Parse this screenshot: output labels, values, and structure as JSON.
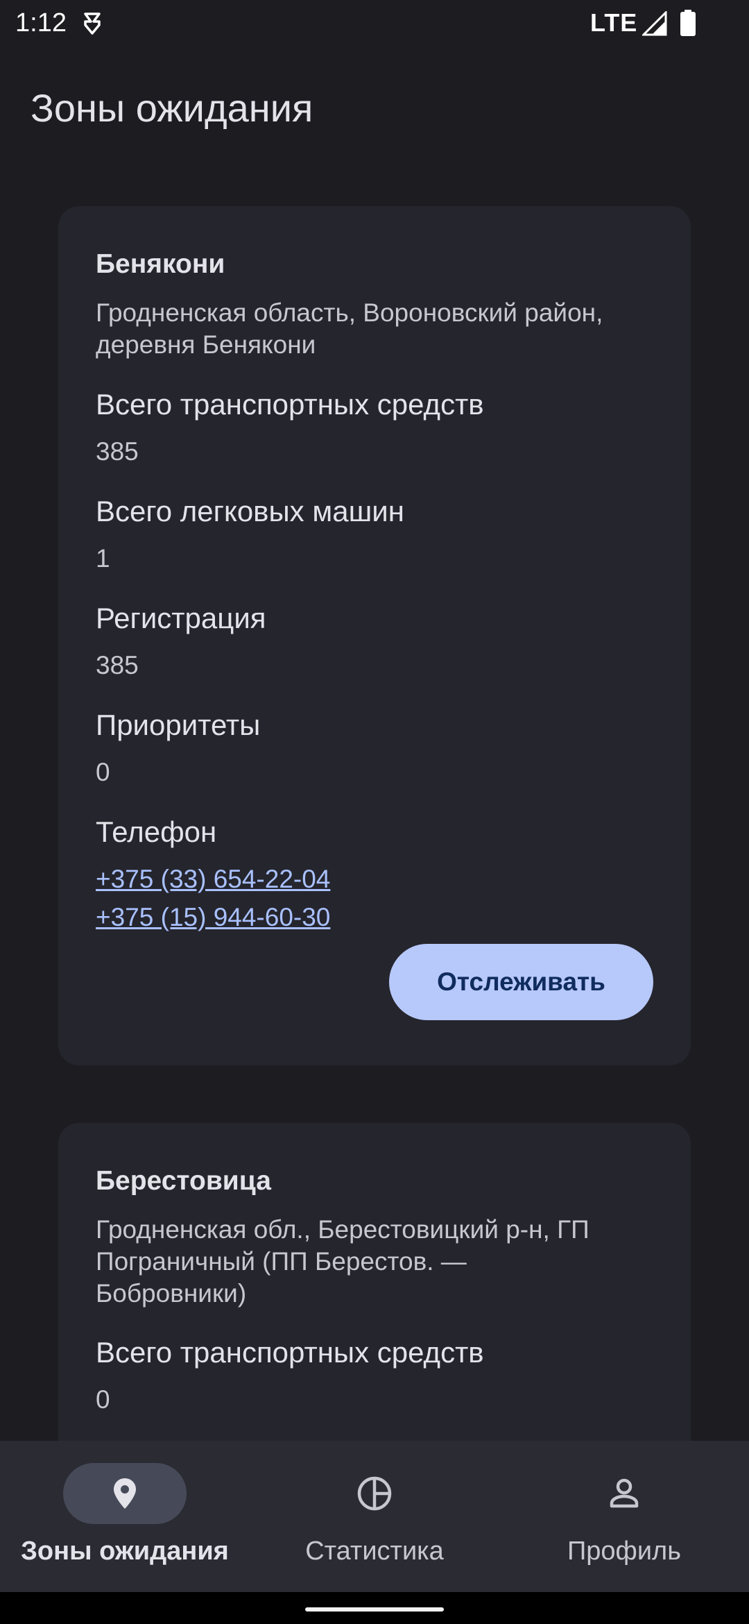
{
  "status_bar": {
    "time": "1:12",
    "network": "LTE",
    "icons": [
      "app-notification-icon",
      "signal-icon",
      "battery-icon"
    ]
  },
  "header": {
    "title": "Зоны ожидания"
  },
  "zones": [
    {
      "name": "Бенякони",
      "address": "Гродненская область, Вороновский район, деревня Бенякони",
      "fields": [
        {
          "label": "Всего транспортных средств",
          "value": "385"
        },
        {
          "label": "Всего легковых машин",
          "value": "1"
        },
        {
          "label": "Регистрация",
          "value": "385"
        },
        {
          "label": "Приоритеты",
          "value": "0"
        }
      ],
      "phone_label": "Телефон",
      "phones": [
        "+375 (33) 654-22-04",
        "+375 (15) 944-60-30"
      ],
      "track_button": "Отслеживать"
    },
    {
      "name": "Берестовица",
      "address": "Гродненская обл., Берестовицкий р-н, ГП Пограничный (ПП Берестов. — Бобровники)",
      "fields": [
        {
          "label": "Всего транспортных средств",
          "value": "0"
        }
      ]
    }
  ],
  "bottom_nav": {
    "items": [
      {
        "label": "Зоны ожидания",
        "icon": "location-pin-icon",
        "active": true
      },
      {
        "label": "Статистика",
        "icon": "pie-chart-icon",
        "active": false
      },
      {
        "label": "Профиль",
        "icon": "person-icon",
        "active": false
      }
    ]
  },
  "colors": {
    "background": "#1c1c21",
    "card": "#25252d",
    "accent_button": "#b7c8fb",
    "link": "#a9c1ff",
    "nav_bar": "#2a2b33",
    "nav_active_pill": "#464a58"
  }
}
